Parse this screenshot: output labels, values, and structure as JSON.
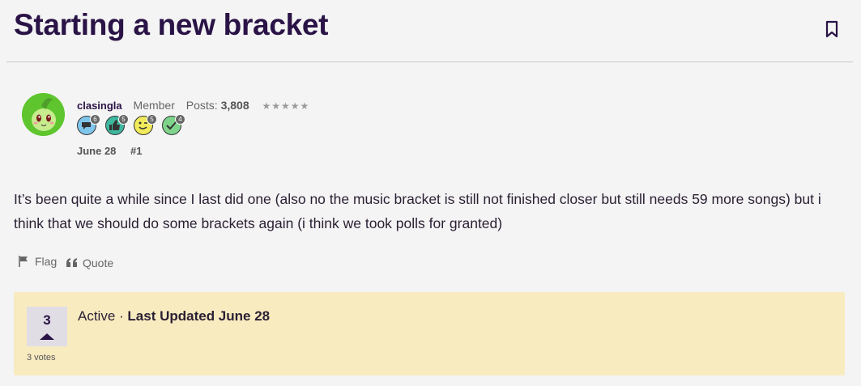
{
  "discussion": {
    "title": "Starting a new bracket"
  },
  "post": {
    "author": "clasingla",
    "role": "Member",
    "posts_label": "Posts:",
    "posts_count": "3,808",
    "stars": "★★★★★",
    "badges": [
      {
        "name": "comment-badge-icon",
        "count": "6",
        "color": "#7fc6ec"
      },
      {
        "name": "like-badge-icon",
        "count": "5",
        "color": "#3fb8a0"
      },
      {
        "name": "wink-badge-icon",
        "count": "5",
        "color": "#f1ea5a"
      },
      {
        "name": "check-badge-icon",
        "count": "4",
        "color": "#7fd48b"
      }
    ],
    "date": "June 28",
    "number": "#1",
    "body": "It’s been quite a while since I last did one (also no the music bracket is still not finished closer but still needs 59 more songs) but i think that we should do some brackets again (i think we took polls for granted)",
    "actions": {
      "flag": "Flag",
      "quote": "Quote"
    }
  },
  "info_panel": {
    "vote_count": "3",
    "votes_label": "3 votes",
    "status": "Active",
    "separator": " · ",
    "last_updated": "Last Updated June 28"
  }
}
